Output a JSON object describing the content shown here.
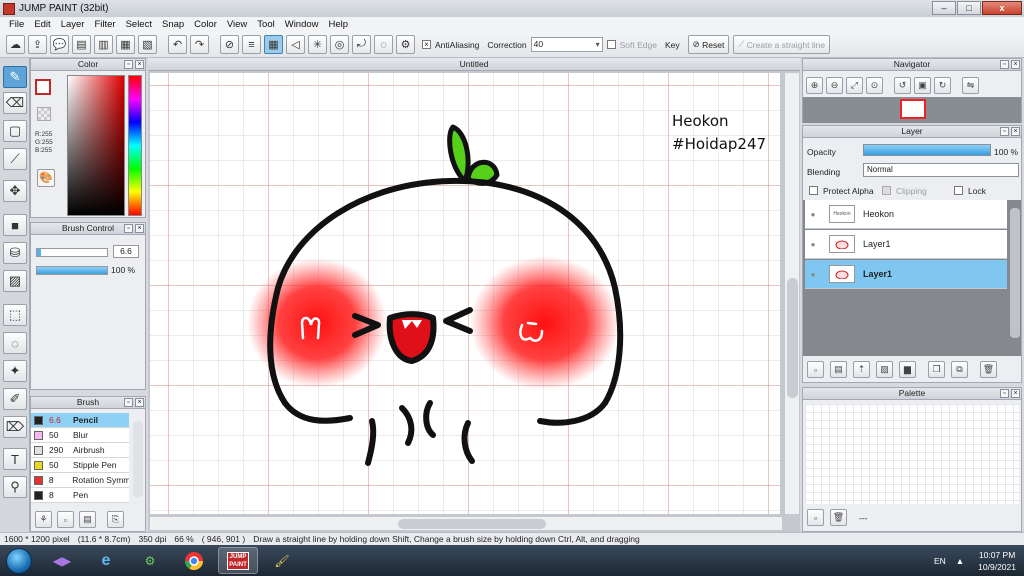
{
  "window": {
    "title": "JUMP PAINT (32bit)",
    "minimize": "–",
    "maximize": "□",
    "close": "x"
  },
  "menu": [
    "File",
    "Edit",
    "Layer",
    "Filter",
    "Select",
    "Snap",
    "Color",
    "View",
    "Tool",
    "Window",
    "Help"
  ],
  "toolbar": {
    "antialiasing_label": "AntiAliasing",
    "correction_label": "Correction",
    "correction_value": "40",
    "soft_edge_label": "Soft Edge",
    "key_label": "Key",
    "reset_label": "Reset",
    "straight_line_label": "Create a straight line"
  },
  "color_panel": {
    "title": "Color",
    "r": "R:255",
    "g": "G:255",
    "b": "B:255",
    "fg_color": "#ffffff",
    "bg_color": "#ffffff"
  },
  "brush_control": {
    "title": "Brush Control",
    "size": "6.6",
    "opacity": "100 %"
  },
  "brush_panel": {
    "title": "Brush",
    "items": [
      {
        "size": "6.6",
        "name": "Pencil",
        "color": "#222222",
        "selected": true
      },
      {
        "size": "50",
        "name": "Blur",
        "color": "#f5b8f0",
        "selected": false
      },
      {
        "size": "290",
        "name": "Airbrush",
        "color": "#e0e0e0",
        "selected": false
      },
      {
        "size": "50",
        "name": "Stipple Pen",
        "color": "#e8d820",
        "selected": false
      },
      {
        "size": "8",
        "name": "Rotation Symm",
        "color": "#e83030",
        "selected": false
      },
      {
        "size": "8",
        "name": "Pen",
        "color": "#222222",
        "selected": false
      }
    ]
  },
  "document": {
    "tab": "Untitled"
  },
  "canvas_text": {
    "line1": "Heokon",
    "line2": "#Hoidap247"
  },
  "navigator": {
    "title": "Navigator"
  },
  "layer_panel": {
    "title": "Layer",
    "opacity_label": "Opacity",
    "opacity_value": "100 %",
    "blending_label": "Blending",
    "blending_value": "Normal",
    "protect_alpha": "Protect Alpha",
    "clipping": "Clipping",
    "lock": "Lock",
    "layers": [
      {
        "name": "Heokon",
        "selected": false
      },
      {
        "name": "Layer1",
        "selected": false
      },
      {
        "name": "Layer1",
        "selected": true
      }
    ]
  },
  "palette": {
    "title": "Palette",
    "footer": "---"
  },
  "status": {
    "size": "1600 * 1200 pixel",
    "cm": "(11.6 * 8.7cm)",
    "dpi": "350 dpi",
    "zoom": "66 %",
    "coords": "( 946, 901 )",
    "hint": "Draw a straight line by holding down Shift, Change a brush size by holding down Ctrl, Alt, and dragging"
  },
  "taskbar": {
    "lang": "EN",
    "time": "10:07 PM",
    "date": "10/9/2021"
  }
}
